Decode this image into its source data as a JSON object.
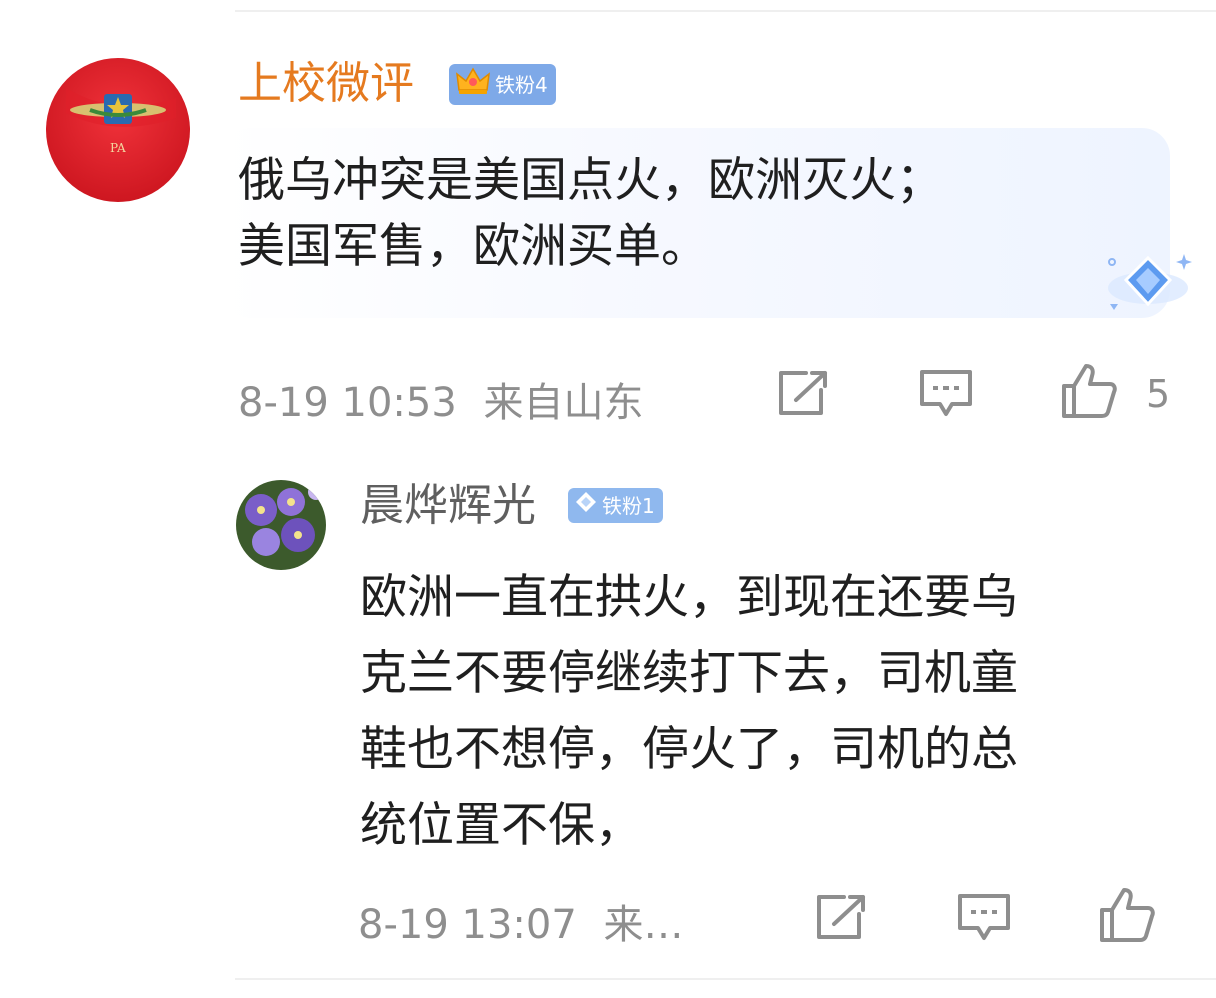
{
  "comment": {
    "user": "上校微评",
    "badge": "铁粉4",
    "text_line1": "俄乌冲突是美国点火，欧洲灭火；",
    "text_line2": "美国军售，欧洲买单。",
    "time": "8-19 10:53",
    "location": "来自山东",
    "likes": "5"
  },
  "reply": {
    "user": "晨烨辉光",
    "badge": "铁粉1",
    "text_line1": "欧洲一直在拱火，到现在还要乌",
    "text_line2": "克兰不要停继续打下去，司机童",
    "text_line3": "鞋也不想停，停火了，司机的总",
    "text_line4": "统位置不保，",
    "time": "8-19 13:07",
    "location_truncated": "来…"
  },
  "colors": {
    "username": "#e57a1f",
    "badge": "#7ea9e8",
    "meta": "#8e8e8e"
  },
  "icons": [
    "share-icon",
    "comment-icon",
    "like-icon",
    "crown-icon",
    "diamond-icon"
  ]
}
